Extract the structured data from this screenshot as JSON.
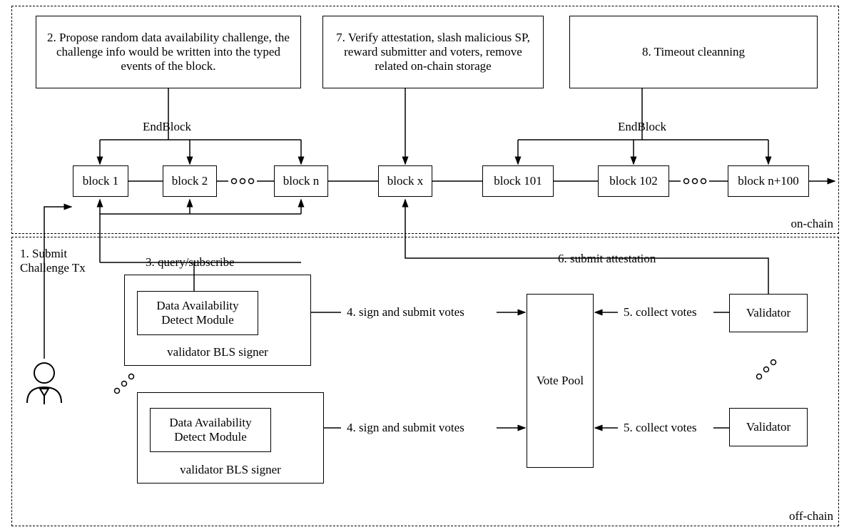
{
  "regions": {
    "onchain": "on-chain",
    "offchain": "off-chain"
  },
  "steps": {
    "s1": "1. Submit Challenge Tx",
    "s2": "2. Propose random data availability challenge, the challenge info would be written into the typed events of the block.",
    "s3": "3. query/subscribe",
    "s4": "4. sign and submit votes",
    "s5": "5. collect votes",
    "s6": "6. submit attestation",
    "s7": "7. Verify attestation, slash malicious SP, reward submitter and voters, remove related on-chain storage",
    "s8": "8. Timeout cleanning"
  },
  "labels": {
    "endblock": "EndBlock"
  },
  "blocks": {
    "b1": "block 1",
    "b2": "block 2",
    "bn": "block n",
    "bx": "block x",
    "b101": "block 101",
    "b102": "block 102",
    "bn100": "block n+100"
  },
  "offchain": {
    "detect": "Data Availability Detect Module",
    "signer": "validator BLS signer",
    "votepool": "Vote Pool",
    "validator": "Validator"
  }
}
